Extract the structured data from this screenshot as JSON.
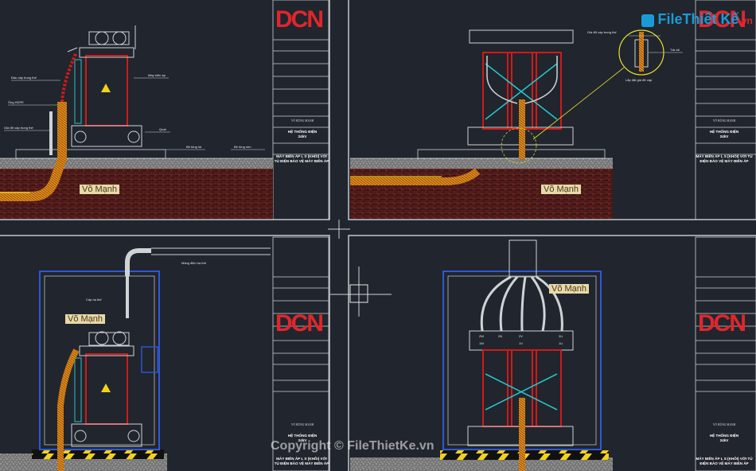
{
  "site_logo": {
    "text_1": "File",
    "text_2": "Thiết Kế",
    "text_3": ".vn",
    "colors": {
      "primary": "#1a9bd7",
      "accent": "#e0262c"
    }
  },
  "watermark": "Copyright © FileThietKe.vn",
  "author_tag": "Võ Mạnh",
  "title_block": {
    "logo": "DCN",
    "designer": "VÕ HÙNG MẠNH",
    "system": "HỆ THỐNG ĐIỆN\n24kV",
    "sheet_title": "MÁY BIẾN ÁP L S (KHÔI) VỚI TỦ ĐIỆN BẢO VỆ MÁY BIẾN ÁP",
    "sheet_title_partial": "MÁY BIẾN ÁP L S (KHÔI) VỚI TỦ ĐIỆN BẢO VỆ MÁY BIẾN ÁP"
  },
  "labels": {
    "q1": {
      "dau_cap": "Đầu cáp trung thế",
      "ong_hdpe": "Ống HDPE",
      "gia_do": "Giá đỡ cáp trung thế",
      "may_bien_ap": "Máy biến áp",
      "quat": "Quạt",
      "be_mong": "Bê tông lót",
      "nen": "Bê tông nền"
    },
    "q2": {
      "gia_do": "Giá đỡ cáp trung thế",
      "tu_ke": "Tấc kê",
      "lap_dat": "Lắp đặt giá đỡ cáp"
    },
    "q3": {
      "mang_dien": "Máng điện hạ thế",
      "cap_ha_the": "Cáp hạ thế"
    },
    "q4": {
      "terminals": [
        "2W",
        "2V",
        "2U",
        "1W",
        "1V",
        "1U",
        "2N"
      ]
    }
  },
  "colors": {
    "background": "#21252d",
    "frame": "#cfd3d6",
    "transformer": "#d11a1a",
    "ground": "#7b1f1f",
    "cable": "#e18a1b",
    "cyan": "#27c2c8",
    "blue": "#2f57d9",
    "yellow": "#f2d21c"
  }
}
